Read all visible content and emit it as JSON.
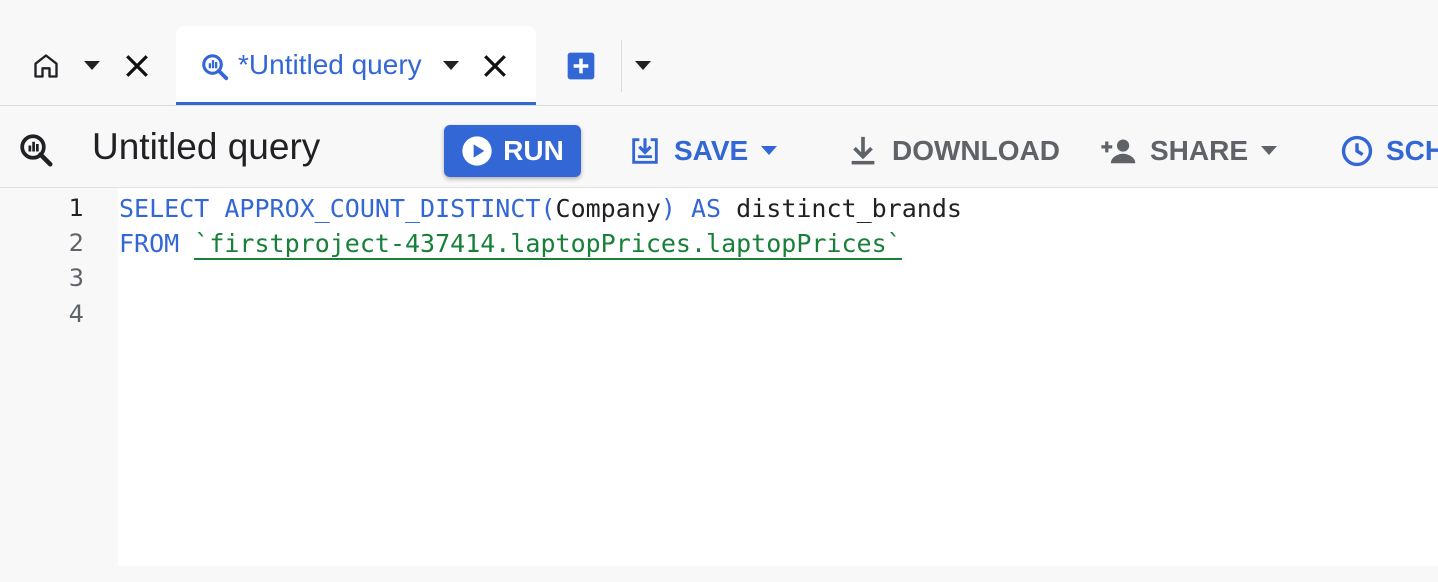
{
  "tabs": {
    "home": {
      "icon": "home-icon"
    },
    "active": {
      "label": "*Untitled query",
      "icon": "query-icon"
    },
    "add": {
      "icon": "add-box-icon"
    }
  },
  "toolbar": {
    "title": "Untitled query",
    "run_label": "RUN",
    "save_label": "SAVE",
    "download_label": "DOWNLOAD",
    "share_label": "SHARE",
    "schedule_label": "SCH"
  },
  "editor": {
    "line_numbers": [
      "1",
      "2",
      "3",
      "4"
    ],
    "line1": {
      "select": "SELECT",
      "fn": "APPROX_COUNT_DISTINCT",
      "open_paren": "(",
      "arg": "Company",
      "close_paren": ")",
      "as": "AS",
      "alias": "distinct_brands"
    },
    "line2": {
      "from": "FROM",
      "table": "`firstproject-437414.laptopPrices.laptopPrices`"
    }
  },
  "colors": {
    "accent": "#3367d6",
    "string": "#188038",
    "icon_gray": "#5f6368",
    "text": "#202124"
  }
}
